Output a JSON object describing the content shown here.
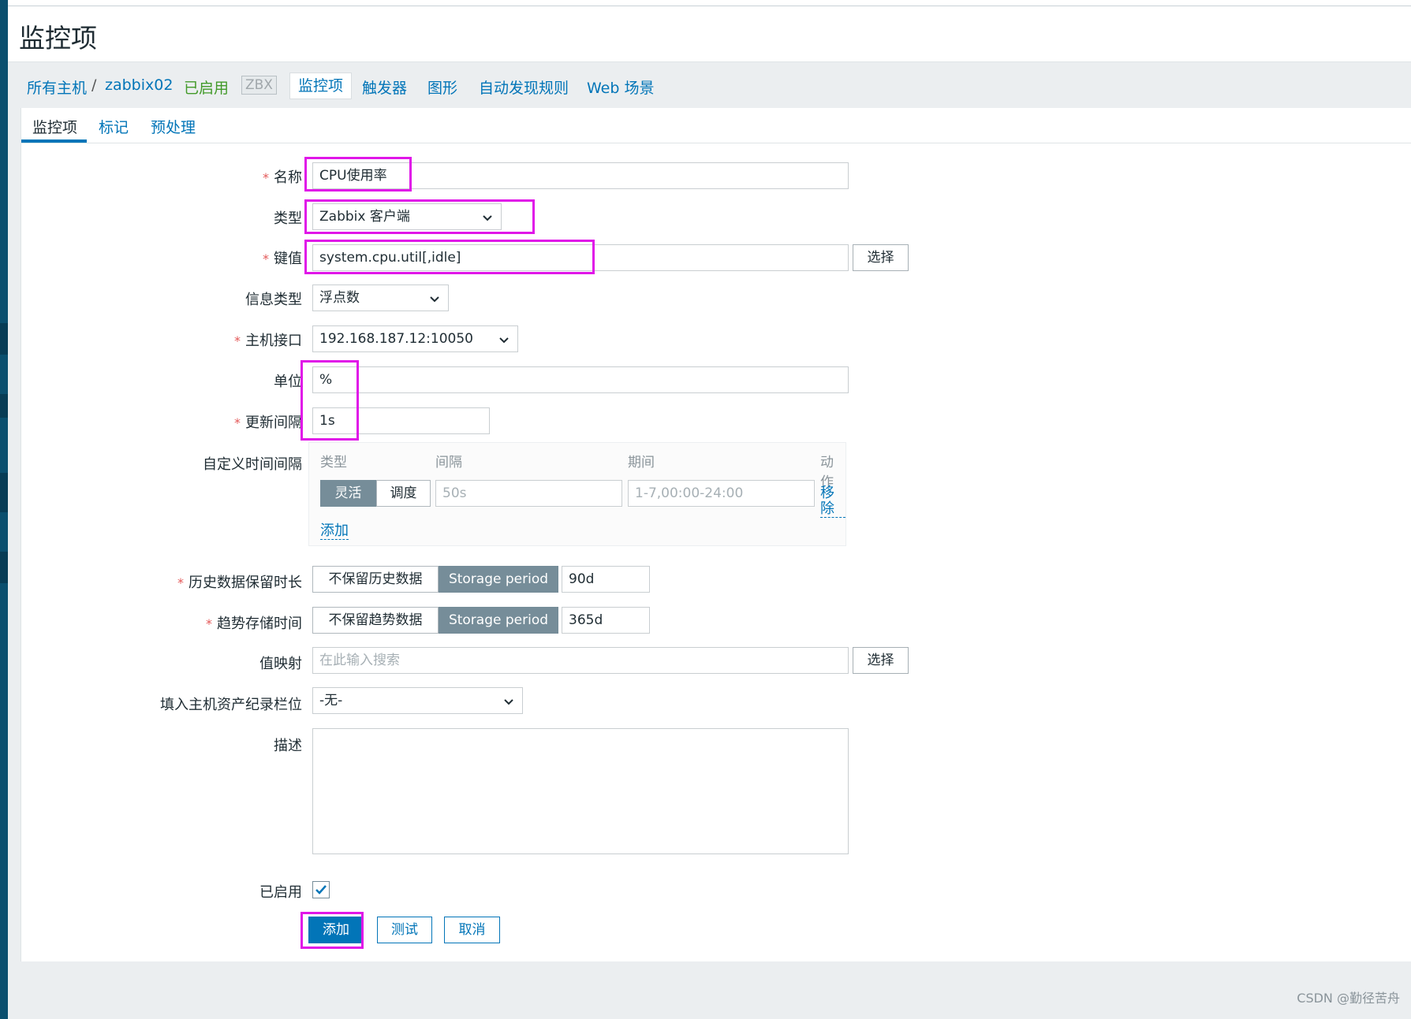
{
  "page": {
    "title": "监控项"
  },
  "breadcrumb": {
    "all_hosts": "所有主机",
    "separator": "/",
    "host": "zabbix02",
    "status": "已启用",
    "zbx_badge": "ZBX",
    "items": "监控项",
    "triggers": "触发器",
    "graphs": "图形",
    "discovery": "自动发现规则",
    "web": "Web 场景"
  },
  "tabs": [
    "监控项",
    "标记",
    "预处理"
  ],
  "form": {
    "name": {
      "label": "名称",
      "value": "CPU使用率"
    },
    "type": {
      "label": "类型",
      "value": "Zabbix 客户端"
    },
    "key": {
      "label": "键值",
      "value": "system.cpu.util[,idle]",
      "select_button": "选择"
    },
    "info_type": {
      "label": "信息类型",
      "value": "浮点数"
    },
    "host_interface": {
      "label": "主机接口",
      "value": "192.168.187.12:10050"
    },
    "units": {
      "label": "单位",
      "value": "%"
    },
    "update_interval": {
      "label": "更新间隔",
      "value": "1s"
    },
    "custom_intervals": {
      "label": "自定义时间间隔",
      "headers": {
        "type": "类型",
        "interval": "间隔",
        "period": "期间",
        "action": "动作"
      },
      "row": {
        "flexible": "灵活",
        "scheduling": "调度",
        "interval_placeholder": "50s",
        "period_placeholder": "1-7,00:00-24:00",
        "remove": "移除"
      },
      "add": "添加"
    },
    "history": {
      "label": "历史数据保留时长",
      "no_keep": "不保留历史数据",
      "storage": "Storage period",
      "value": "90d"
    },
    "trends": {
      "label": "趋势存储时间",
      "no_keep": "不保留趋势数据",
      "storage": "Storage period",
      "value": "365d"
    },
    "value_map": {
      "label": "值映射",
      "placeholder": "在此输入搜索",
      "select_button": "选择"
    },
    "inventory": {
      "label": "填入主机资产纪录栏位",
      "value": "-无-"
    },
    "description": {
      "label": "描述",
      "value": ""
    },
    "enabled": {
      "label": "已启用",
      "checked": true
    },
    "buttons": {
      "add": "添加",
      "test": "测试",
      "cancel": "取消"
    }
  },
  "credit": "CSDN @勤径苦舟",
  "colors": {
    "accent": "#0275b8",
    "highlight": "#e016e8",
    "required": "#e45959"
  }
}
